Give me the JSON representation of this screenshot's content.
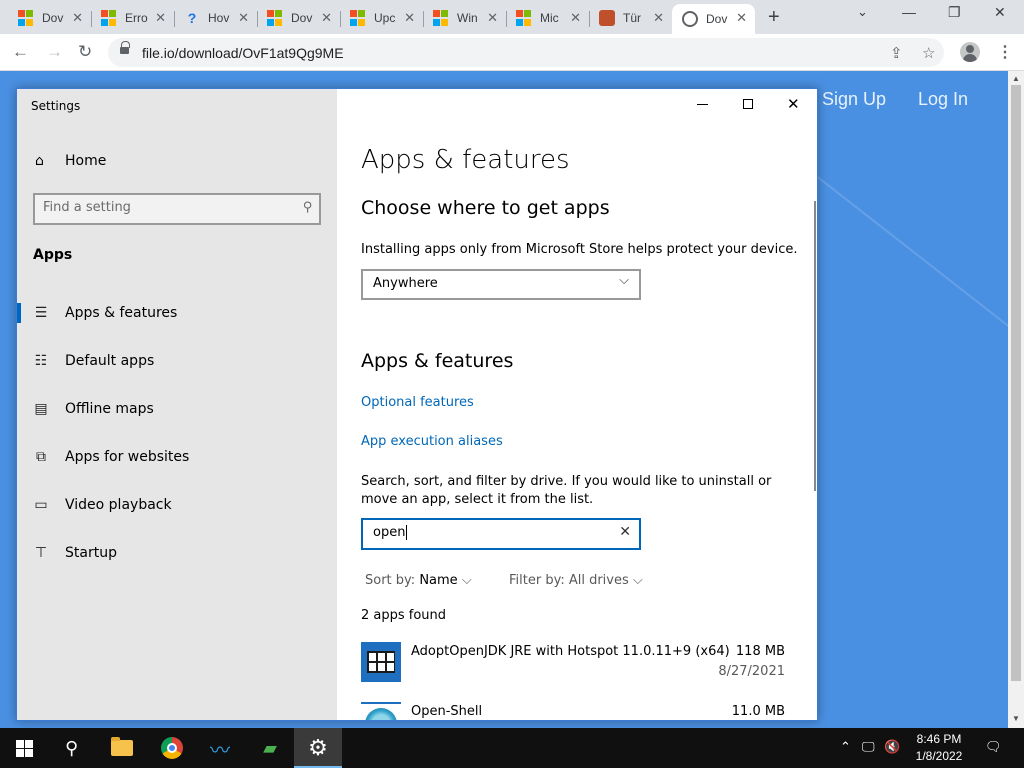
{
  "browser": {
    "tabs": [
      {
        "title": "Dov",
        "icon": "microsoft-icon"
      },
      {
        "title": "Erro",
        "icon": "microsoft-icon"
      },
      {
        "title": "Hov",
        "icon": "help-icon"
      },
      {
        "title": "Dov",
        "icon": "microsoft-icon"
      },
      {
        "title": "Upc",
        "icon": "microsoft-icon"
      },
      {
        "title": "Win",
        "icon": "microsoft-icon"
      },
      {
        "title": "Mic",
        "icon": "microsoft-icon"
      },
      {
        "title": "Tür",
        "icon": "monster-icon"
      },
      {
        "title": "Dov",
        "icon": "globe-icon",
        "active": true
      }
    ],
    "url": "file.io/download/OvF1at9Qg9ME",
    "page_links": {
      "sign_up": "Sign Up",
      "log_in": "Log In"
    },
    "page_color": "#4a90e2"
  },
  "settings": {
    "window_title": "Settings",
    "sidebar": {
      "home": "Home",
      "search_placeholder": "Find a setting",
      "section": "Apps",
      "items": [
        {
          "label": "Apps & features",
          "icon": "list-icon",
          "selected": true
        },
        {
          "label": "Default apps",
          "icon": "default-apps-icon"
        },
        {
          "label": "Offline maps",
          "icon": "map-icon"
        },
        {
          "label": "Apps for websites",
          "icon": "web-icon"
        },
        {
          "label": "Video playback",
          "icon": "video-icon"
        },
        {
          "label": "Startup",
          "icon": "startup-icon"
        }
      ]
    },
    "content": {
      "page_title": "Apps & features",
      "choose_heading": "Choose where to get apps",
      "choose_desc": "Installing apps only from Microsoft Store helps protect your device.",
      "source_selected": "Anywhere",
      "apps_heading": "Apps & features",
      "optional_features": "Optional features",
      "execution_aliases": "App execution aliases",
      "search_desc": "Search, sort, and filter by drive. If you would like to uninstall or move an app, select it from the list.",
      "search_value": "open",
      "sort_label": "Sort by:",
      "sort_value": "Name",
      "filter_label": "Filter by: All drives",
      "found_count": "2 apps found",
      "apps": [
        {
          "name": "AdoptOpenJDK JRE with Hotspot 11.0.11+9 (x64)",
          "size": "118 MB",
          "date": "8/27/2021"
        },
        {
          "name": "Open-Shell",
          "size": "11.0 MB",
          "date": ""
        }
      ],
      "accent": "#0067b8"
    }
  },
  "taskbar": {
    "time": "8:46 PM",
    "date": "1/8/2022"
  }
}
